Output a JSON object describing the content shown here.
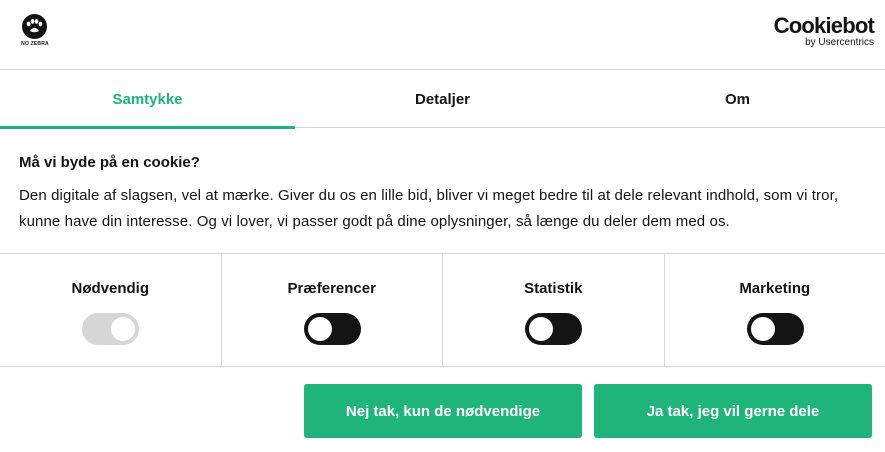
{
  "header": {
    "brand_text": "NO ZEBRA",
    "brand_icon": "paw-icon",
    "cookiebot_name": "Cookiebot",
    "cookiebot_sub": "by Usercentrics"
  },
  "tabs": [
    {
      "label": "Samtykke",
      "active": true
    },
    {
      "label": "Detaljer",
      "active": false
    },
    {
      "label": "Om",
      "active": false
    }
  ],
  "consent": {
    "title": "Må vi byde på en cookie?",
    "description": "Den digitale af slagsen, vel at mærke. Giver du os en lille bid, bliver vi meget bedre til at dele relevant indhold, som vi tror, kunne have din interesse. Og vi lover, vi passer godt på dine oplysninger, så længe du deler dem med os."
  },
  "toggles": [
    {
      "label": "Nødvendig",
      "enabled": true,
      "disabled": true
    },
    {
      "label": "Præferencer",
      "enabled": false,
      "disabled": false
    },
    {
      "label": "Statistik",
      "enabled": false,
      "disabled": false
    },
    {
      "label": "Marketing",
      "enabled": false,
      "disabled": false
    }
  ],
  "buttons": {
    "necessary_only": "Nej tak, kun de nødvendige",
    "accept_all": "Ja tak, jeg vil gerne dele"
  },
  "colors": {
    "accent": "#1fb57a",
    "text": "#141414",
    "divider": "#d6d6d6",
    "toggle_off": "#141414",
    "toggle_disabled": "#d6d6d6"
  }
}
